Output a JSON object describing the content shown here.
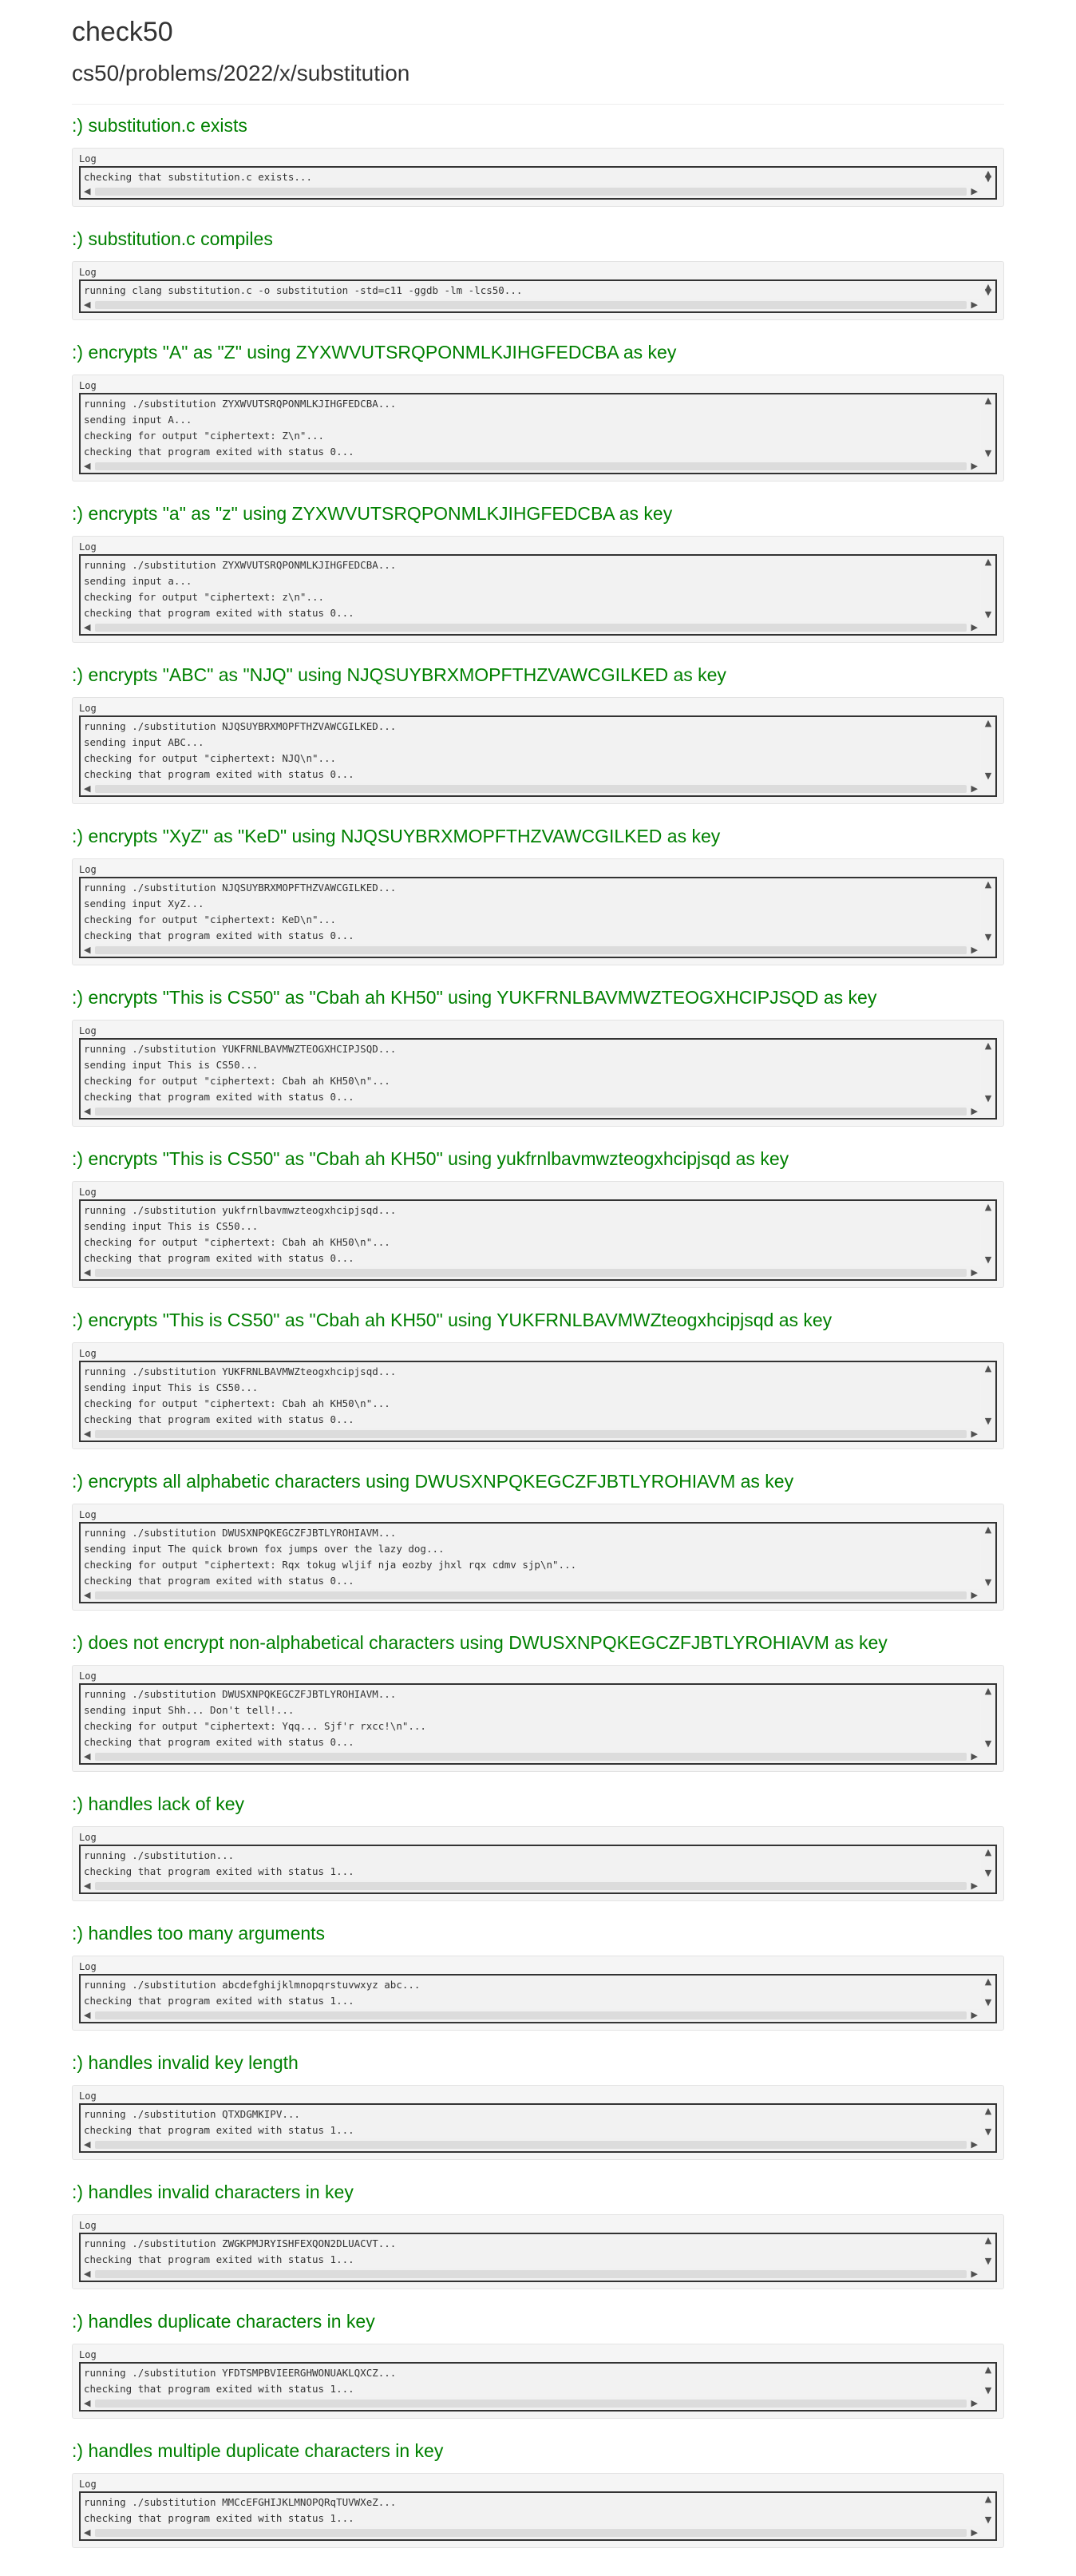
{
  "header": {
    "title": "check50",
    "slug": "cs50/problems/2022/x/substitution"
  },
  "log_label": "Log",
  "icons": {
    "up": "scroll-up-icon",
    "down": "scroll-down-icon",
    "left": "scroll-left-icon",
    "right": "scroll-right-icon"
  },
  "colors": {
    "pass": "#008000"
  },
  "checks": [
    {
      "title": ":) substitution.c exists",
      "log": [
        "checking that substitution.c exists..."
      ]
    },
    {
      "title": ":) substitution.c compiles",
      "log": [
        "running clang substitution.c -o substitution -std=c11 -ggdb -lm -lcs50..."
      ]
    },
    {
      "title": ":) encrypts \"A\" as \"Z\" using ZYXWVUTSRQPONMLKJIHGFEDCBA as key",
      "log": [
        "running ./substitution ZYXWVUTSRQPONMLKJIHGFEDCBA...",
        "sending input A...",
        "checking for output \"ciphertext: Z\\n\"...",
        "checking that program exited with status 0..."
      ]
    },
    {
      "title": ":) encrypts \"a\" as \"z\" using ZYXWVUTSRQPONMLKJIHGFEDCBA as key",
      "log": [
        "running ./substitution ZYXWVUTSRQPONMLKJIHGFEDCBA...",
        "sending input a...",
        "checking for output \"ciphertext: z\\n\"...",
        "checking that program exited with status 0..."
      ]
    },
    {
      "title": ":) encrypts \"ABC\" as \"NJQ\" using NJQSUYBRXMOPFTHZVAWCGILKED as key",
      "log": [
        "running ./substitution NJQSUYBRXMOPFTHZVAWCGILKED...",
        "sending input ABC...",
        "checking for output \"ciphertext: NJQ\\n\"...",
        "checking that program exited with status 0..."
      ]
    },
    {
      "title": ":) encrypts \"XyZ\" as \"KeD\" using NJQSUYBRXMOPFTHZVAWCGILKED as key",
      "log": [
        "running ./substitution NJQSUYBRXMOPFTHZVAWCGILKED...",
        "sending input XyZ...",
        "checking for output \"ciphertext: KeD\\n\"...",
        "checking that program exited with status 0..."
      ]
    },
    {
      "title": ":) encrypts \"This is CS50\" as \"Cbah ah KH50\" using YUKFRNLBAVMWZTEOGXHCIPJSQD as key",
      "log": [
        "running ./substitution YUKFRNLBAVMWZTEOGXHCIPJSQD...",
        "sending input This is CS50...",
        "checking for output \"ciphertext: Cbah ah KH50\\n\"...",
        "checking that program exited with status 0..."
      ]
    },
    {
      "title": ":) encrypts \"This is CS50\" as \"Cbah ah KH50\" using yukfrnlbavmwzteogxhcipjsqd as key",
      "log": [
        "running ./substitution yukfrnlbavmwzteogxhcipjsqd...",
        "sending input This is CS50...",
        "checking for output \"ciphertext: Cbah ah KH50\\n\"...",
        "checking that program exited with status 0..."
      ]
    },
    {
      "title": ":) encrypts \"This is CS50\" as \"Cbah ah KH50\" using YUKFRNLBAVMWZteogxhcipjsqd as key",
      "log": [
        "running ./substitution YUKFRNLBAVMWZteogxhcipjsqd...",
        "sending input This is CS50...",
        "checking for output \"ciphertext: Cbah ah KH50\\n\"...",
        "checking that program exited with status 0..."
      ]
    },
    {
      "title": ":) encrypts all alphabetic characters using DWUSXNPQKEGCZFJBTLYROHIAVM as key",
      "log": [
        "running ./substitution DWUSXNPQKEGCZFJBTLYROHIAVM...",
        "sending input The quick brown fox jumps over the lazy dog...",
        "checking for output \"ciphertext: Rqx tokug wljif nja eozby jhxl rqx cdmv sjp\\n\"...",
        "checking that program exited with status 0..."
      ]
    },
    {
      "title": ":) does not encrypt non-alphabetical characters using DWUSXNPQKEGCZFJBTLYROHIAVM as key",
      "log": [
        "running ./substitution DWUSXNPQKEGCZFJBTLYROHIAVM...",
        "sending input Shh... Don't tell!...",
        "checking for output \"ciphertext: Yqq... Sjf'r rxcc!\\n\"...",
        "checking that program exited with status 0..."
      ]
    },
    {
      "title": ":) handles lack of key",
      "log": [
        "running ./substitution...",
        "checking that program exited with status 1..."
      ]
    },
    {
      "title": ":) handles too many arguments",
      "log": [
        "running ./substitution abcdefghijklmnopqrstuvwxyz abc...",
        "checking that program exited with status 1..."
      ]
    },
    {
      "title": ":) handles invalid key length",
      "log": [
        "running ./substitution QTXDGMKIPV...",
        "checking that program exited with status 1..."
      ]
    },
    {
      "title": ":) handles invalid characters in key",
      "log": [
        "running ./substitution ZWGKPMJRYISHFEXQON2DLUACVT...",
        "checking that program exited with status 1..."
      ]
    },
    {
      "title": ":) handles duplicate characters in key",
      "log": [
        "running ./substitution YFDTSMPBVIEERGHWONUAKLQXCZ...",
        "checking that program exited with status 1..."
      ]
    },
    {
      "title": ":) handles multiple duplicate characters in key",
      "log": [
        "running ./substitution MMCcEFGHIJKLMNOPQRqTUVWXeZ...",
        "checking that program exited with status 1..."
      ]
    }
  ]
}
